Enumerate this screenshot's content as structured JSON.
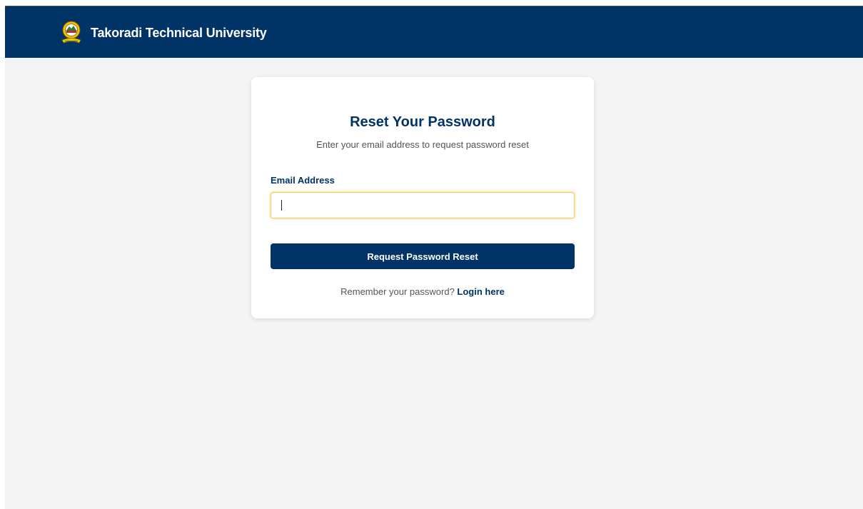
{
  "header": {
    "university_name": "Takoradi Technical University",
    "logo_icon": "university-crest-icon",
    "background_color": "#003366"
  },
  "form": {
    "title": "Reset Your Password",
    "subtitle": "Enter your email address to request password reset",
    "email_label": "Email Address",
    "email_value": "",
    "email_placeholder": "",
    "submit_label": "Request Password Reset",
    "remember_text": "Remember your password?",
    "login_link": "Login here"
  },
  "colors": {
    "primary": "#003366",
    "page_background": "#f4f4f4",
    "input_focus_border": "#f2c94c"
  }
}
